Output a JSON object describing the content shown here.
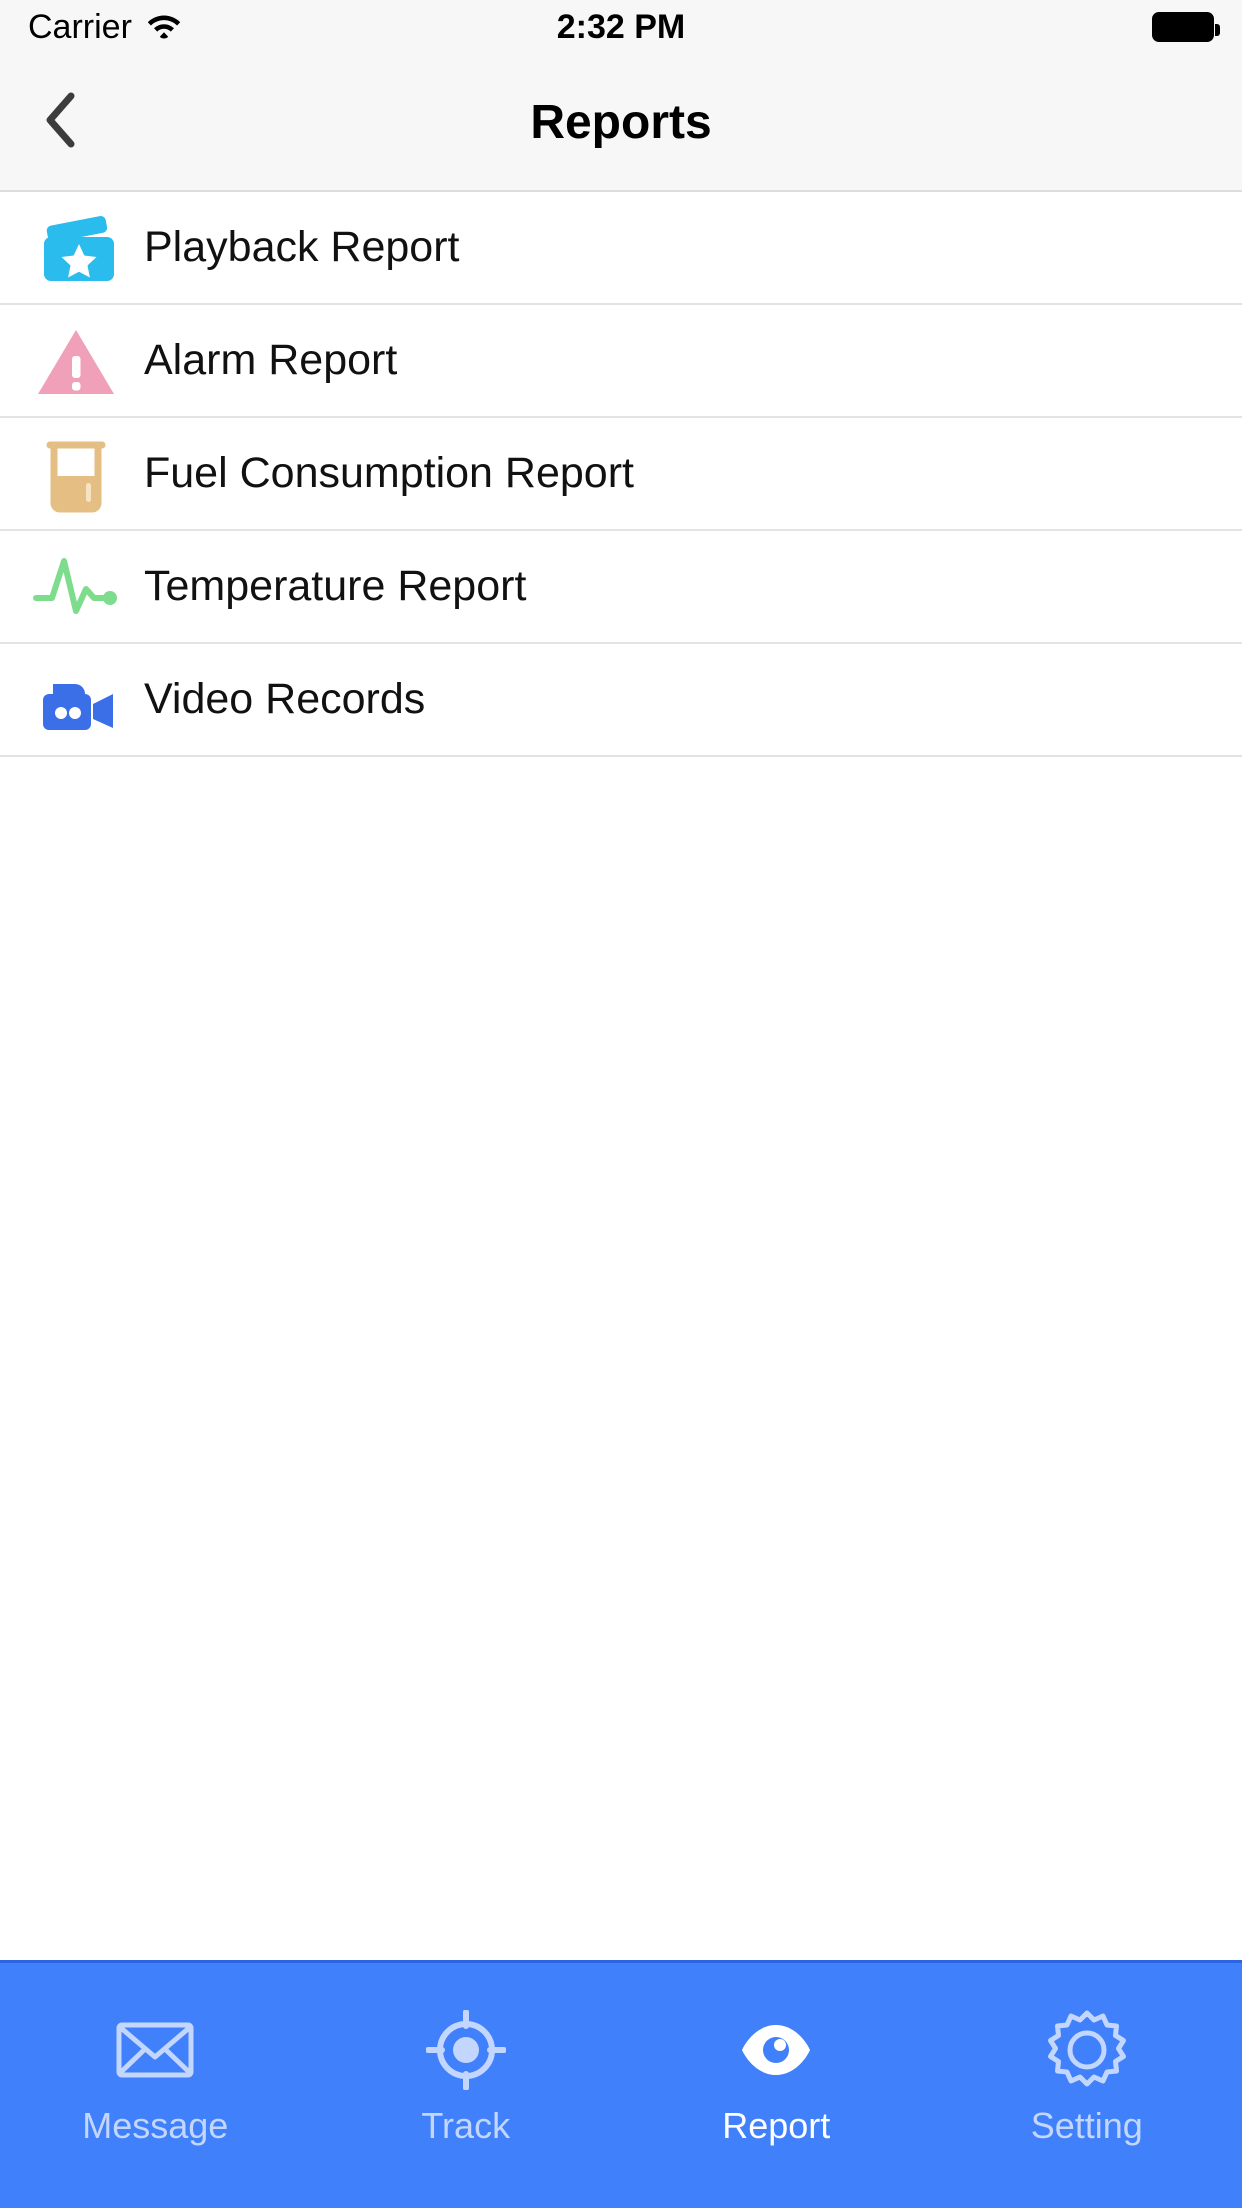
{
  "status_bar": {
    "carrier": "Carrier",
    "time": "2:32 PM",
    "wifi_icon": "wifi-icon",
    "battery_icon": "battery-full-icon"
  },
  "nav_bar": {
    "title": "Reports",
    "back_icon": "chevron-left-icon"
  },
  "list": {
    "items": [
      {
        "label": "Playback Report",
        "icon": "clapperboard-star-icon",
        "color": "#29BCEC"
      },
      {
        "label": "Alarm Report",
        "icon": "warning-triangle-icon",
        "color": "#F0A0B8"
      },
      {
        "label": "Fuel Consumption Report",
        "icon": "fuel-beaker-icon",
        "color": "#E4BE82"
      },
      {
        "label": "Temperature Report",
        "icon": "pulse-wave-icon",
        "color": "#7EDC8D"
      },
      {
        "label": "Video Records",
        "icon": "video-camera-icon",
        "color": "#3B6FE8"
      }
    ]
  },
  "tab_bar": {
    "background": "#4080FB",
    "active_color": "#FFFFFF",
    "inactive_color": "#C3D6FD",
    "tabs": [
      {
        "label": "Message",
        "icon": "envelope-icon",
        "active": false
      },
      {
        "label": "Track",
        "icon": "crosshair-icon",
        "active": false
      },
      {
        "label": "Report",
        "icon": "eye-icon",
        "active": true
      },
      {
        "label": "Setting",
        "icon": "gear-icon",
        "active": false
      }
    ]
  }
}
